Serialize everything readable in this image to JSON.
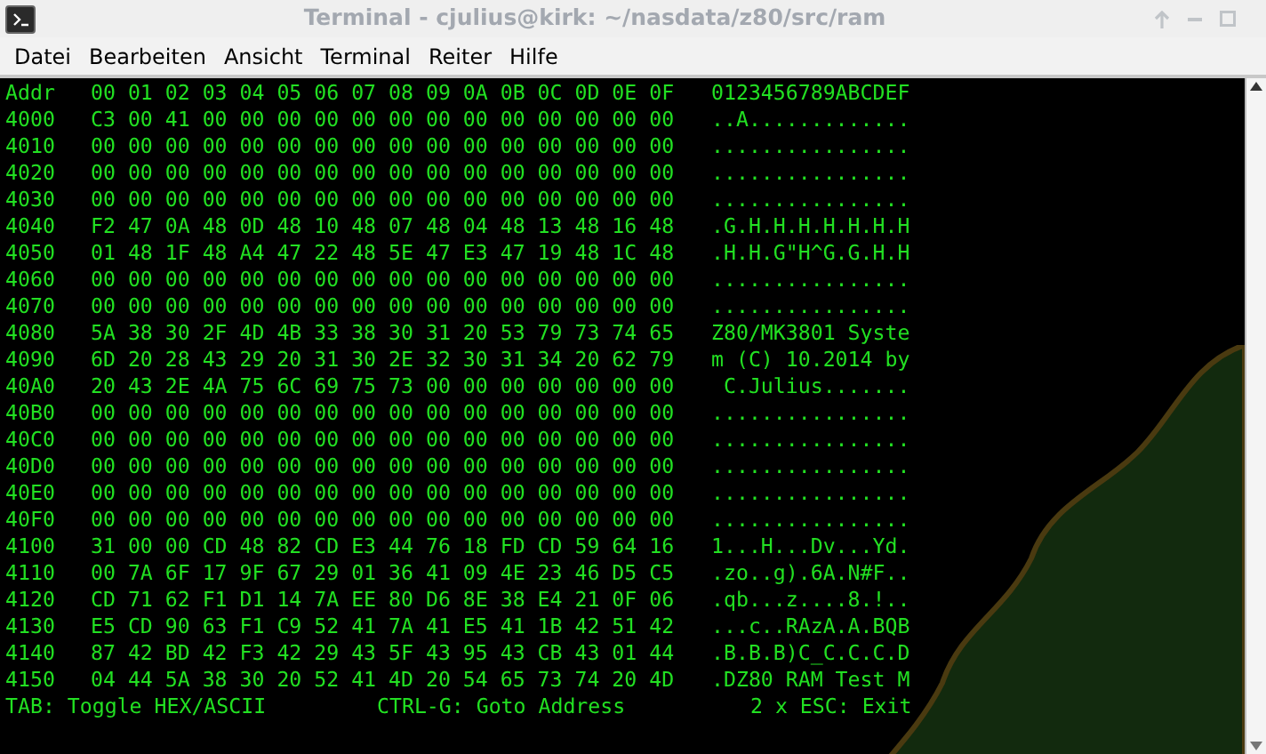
{
  "window": {
    "title": "Terminal - cjulius@kirk: ~/nasdata/z80/src/ram"
  },
  "menu": [
    {
      "label": "Datei"
    },
    {
      "label": "Bearbeiten"
    },
    {
      "label": "Ansicht"
    },
    {
      "label": "Terminal"
    },
    {
      "label": "Reiter"
    },
    {
      "label": "Hilfe"
    }
  ],
  "header": {
    "addr": "Addr",
    "hex": "00 01 02 03 04 05 06 07 08 09 0A 0B 0C 0D 0E 0F",
    "ascii": "0123456789ABCDEF"
  },
  "rows": [
    {
      "addr": "4000",
      "hex": "C3 00 41 00 00 00 00 00 00 00 00 00 00 00 00 00",
      "ascii": "..A............."
    },
    {
      "addr": "4010",
      "hex": "00 00 00 00 00 00 00 00 00 00 00 00 00 00 00 00",
      "ascii": "................"
    },
    {
      "addr": "4020",
      "hex": "00 00 00 00 00 00 00 00 00 00 00 00 00 00 00 00",
      "ascii": "................"
    },
    {
      "addr": "4030",
      "hex": "00 00 00 00 00 00 00 00 00 00 00 00 00 00 00 00",
      "ascii": "................"
    },
    {
      "addr": "4040",
      "hex": "F2 47 0A 48 0D 48 10 48 07 48 04 48 13 48 16 48",
      "ascii": ".G.H.H.H.H.H.H.H"
    },
    {
      "addr": "4050",
      "hex": "01 48 1F 48 A4 47 22 48 5E 47 E3 47 19 48 1C 48",
      "ascii": ".H.H.G\"H^G.G.H.H"
    },
    {
      "addr": "4060",
      "hex": "00 00 00 00 00 00 00 00 00 00 00 00 00 00 00 00",
      "ascii": "................"
    },
    {
      "addr": "4070",
      "hex": "00 00 00 00 00 00 00 00 00 00 00 00 00 00 00 00",
      "ascii": "................"
    },
    {
      "addr": "4080",
      "hex": "5A 38 30 2F 4D 4B 33 38 30 31 20 53 79 73 74 65",
      "ascii": "Z80/MK3801 Syste"
    },
    {
      "addr": "4090",
      "hex": "6D 20 28 43 29 20 31 30 2E 32 30 31 34 20 62 79",
      "ascii": "m (C) 10.2014 by"
    },
    {
      "addr": "40A0",
      "hex": "20 43 2E 4A 75 6C 69 75 73 00 00 00 00 00 00 00",
      "ascii": " C.Julius......."
    },
    {
      "addr": "40B0",
      "hex": "00 00 00 00 00 00 00 00 00 00 00 00 00 00 00 00",
      "ascii": "................"
    },
    {
      "addr": "40C0",
      "hex": "00 00 00 00 00 00 00 00 00 00 00 00 00 00 00 00",
      "ascii": "................"
    },
    {
      "addr": "40D0",
      "hex": "00 00 00 00 00 00 00 00 00 00 00 00 00 00 00 00",
      "ascii": "................"
    },
    {
      "addr": "40E0",
      "hex": "00 00 00 00 00 00 00 00 00 00 00 00 00 00 00 00",
      "ascii": "................"
    },
    {
      "addr": "40F0",
      "hex": "00 00 00 00 00 00 00 00 00 00 00 00 00 00 00 00",
      "ascii": "................"
    },
    {
      "addr": "4100",
      "hex": "31 00 00 CD 48 82 CD E3 44 76 18 FD CD 59 64 16",
      "ascii": "1...H...Dv...Yd."
    },
    {
      "addr": "4110",
      "hex": "00 7A 6F 17 9F 67 29 01 36 41 09 4E 23 46 D5 C5",
      "ascii": ".zo..g).6A.N#F.."
    },
    {
      "addr": "4120",
      "hex": "CD 71 62 F1 D1 14 7A EE 80 D6 8E 38 E4 21 0F 06",
      "ascii": ".qb...z....8.!.."
    },
    {
      "addr": "4130",
      "hex": "E5 CD 90 63 F1 C9 52 41 7A 41 E5 41 1B 42 51 42",
      "ascii": "...c..RAzA.A.BQB"
    },
    {
      "addr": "4140",
      "hex": "87 42 BD 42 F3 42 29 43 5F 43 95 43 CB 43 01 44",
      "ascii": ".B.B.B)C_C.C.C.D"
    },
    {
      "addr": "4150",
      "hex": "04 44 5A 38 30 20 52 41 4D 20 54 65 73 74 20 4D",
      "ascii": ".DZ80 RAM Test M"
    }
  ],
  "status_bar": {
    "toggle": "TAB: Toggle HEX/ASCII",
    "goto": "CTRL-G: Goto Address",
    "exit": "2 x ESC: Exit"
  }
}
